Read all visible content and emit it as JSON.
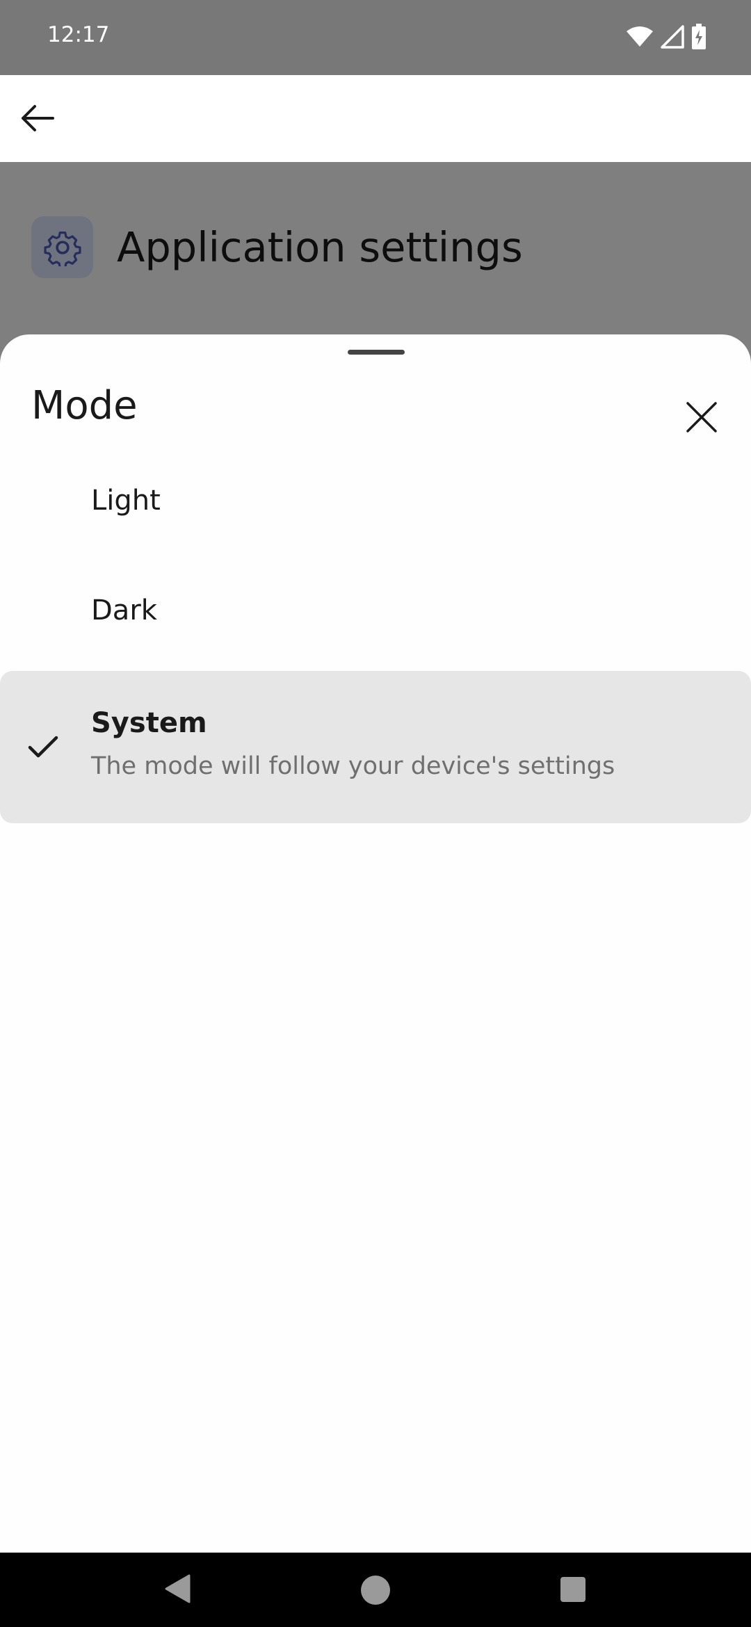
{
  "status_bar": {
    "time": "12:17",
    "icons": [
      "wifi-icon",
      "signal-icon",
      "battery-charging-icon"
    ]
  },
  "app_bar": {
    "back_icon": "arrow-left-icon"
  },
  "background_page": {
    "icon": "gear-icon",
    "title": "Application settings"
  },
  "sheet": {
    "title": "Mode",
    "close_icon": "close-icon",
    "options": [
      {
        "label": "Light",
        "selected": false
      },
      {
        "label": "Dark",
        "selected": false
      },
      {
        "label": "System",
        "description": "The mode will follow your device's settings",
        "selected": true
      }
    ]
  },
  "colors": {
    "status_bar": "#787878",
    "selected_row": "#e6e6e6",
    "icon_accent": "#4a5bb5"
  }
}
